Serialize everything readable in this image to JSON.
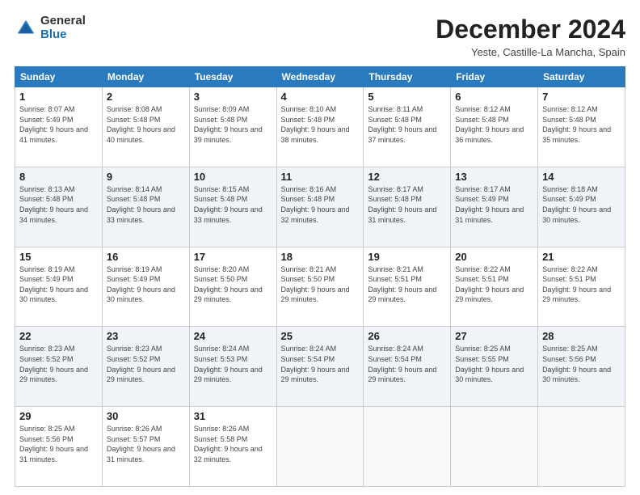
{
  "logo": {
    "general": "General",
    "blue": "Blue"
  },
  "title": "December 2024",
  "subtitle": "Yeste, Castille-La Mancha, Spain",
  "days_of_week": [
    "Sunday",
    "Monday",
    "Tuesday",
    "Wednesday",
    "Thursday",
    "Friday",
    "Saturday"
  ],
  "weeks": [
    [
      {
        "day": "1",
        "sunrise": "8:07 AM",
        "sunset": "5:49 PM",
        "daylight": "9 hours and 41 minutes."
      },
      {
        "day": "2",
        "sunrise": "8:08 AM",
        "sunset": "5:48 PM",
        "daylight": "9 hours and 40 minutes."
      },
      {
        "day": "3",
        "sunrise": "8:09 AM",
        "sunset": "5:48 PM",
        "daylight": "9 hours and 39 minutes."
      },
      {
        "day": "4",
        "sunrise": "8:10 AM",
        "sunset": "5:48 PM",
        "daylight": "9 hours and 38 minutes."
      },
      {
        "day": "5",
        "sunrise": "8:11 AM",
        "sunset": "5:48 PM",
        "daylight": "9 hours and 37 minutes."
      },
      {
        "day": "6",
        "sunrise": "8:12 AM",
        "sunset": "5:48 PM",
        "daylight": "9 hours and 36 minutes."
      },
      {
        "day": "7",
        "sunrise": "8:12 AM",
        "sunset": "5:48 PM",
        "daylight": "9 hours and 35 minutes."
      }
    ],
    [
      {
        "day": "8",
        "sunrise": "8:13 AM",
        "sunset": "5:48 PM",
        "daylight": "9 hours and 34 minutes."
      },
      {
        "day": "9",
        "sunrise": "8:14 AM",
        "sunset": "5:48 PM",
        "daylight": "9 hours and 33 minutes."
      },
      {
        "day": "10",
        "sunrise": "8:15 AM",
        "sunset": "5:48 PM",
        "daylight": "9 hours and 33 minutes."
      },
      {
        "day": "11",
        "sunrise": "8:16 AM",
        "sunset": "5:48 PM",
        "daylight": "9 hours and 32 minutes."
      },
      {
        "day": "12",
        "sunrise": "8:17 AM",
        "sunset": "5:48 PM",
        "daylight": "9 hours and 31 minutes."
      },
      {
        "day": "13",
        "sunrise": "8:17 AM",
        "sunset": "5:49 PM",
        "daylight": "9 hours and 31 minutes."
      },
      {
        "day": "14",
        "sunrise": "8:18 AM",
        "sunset": "5:49 PM",
        "daylight": "9 hours and 30 minutes."
      }
    ],
    [
      {
        "day": "15",
        "sunrise": "8:19 AM",
        "sunset": "5:49 PM",
        "daylight": "9 hours and 30 minutes."
      },
      {
        "day": "16",
        "sunrise": "8:19 AM",
        "sunset": "5:49 PM",
        "daylight": "9 hours and 30 minutes."
      },
      {
        "day": "17",
        "sunrise": "8:20 AM",
        "sunset": "5:50 PM",
        "daylight": "9 hours and 29 minutes."
      },
      {
        "day": "18",
        "sunrise": "8:21 AM",
        "sunset": "5:50 PM",
        "daylight": "9 hours and 29 minutes."
      },
      {
        "day": "19",
        "sunrise": "8:21 AM",
        "sunset": "5:51 PM",
        "daylight": "9 hours and 29 minutes."
      },
      {
        "day": "20",
        "sunrise": "8:22 AM",
        "sunset": "5:51 PM",
        "daylight": "9 hours and 29 minutes."
      },
      {
        "day": "21",
        "sunrise": "8:22 AM",
        "sunset": "5:51 PM",
        "daylight": "9 hours and 29 minutes."
      }
    ],
    [
      {
        "day": "22",
        "sunrise": "8:23 AM",
        "sunset": "5:52 PM",
        "daylight": "9 hours and 29 minutes."
      },
      {
        "day": "23",
        "sunrise": "8:23 AM",
        "sunset": "5:52 PM",
        "daylight": "9 hours and 29 minutes."
      },
      {
        "day": "24",
        "sunrise": "8:24 AM",
        "sunset": "5:53 PM",
        "daylight": "9 hours and 29 minutes."
      },
      {
        "day": "25",
        "sunrise": "8:24 AM",
        "sunset": "5:54 PM",
        "daylight": "9 hours and 29 minutes."
      },
      {
        "day": "26",
        "sunrise": "8:24 AM",
        "sunset": "5:54 PM",
        "daylight": "9 hours and 29 minutes."
      },
      {
        "day": "27",
        "sunrise": "8:25 AM",
        "sunset": "5:55 PM",
        "daylight": "9 hours and 30 minutes."
      },
      {
        "day": "28",
        "sunrise": "8:25 AM",
        "sunset": "5:56 PM",
        "daylight": "9 hours and 30 minutes."
      }
    ],
    [
      {
        "day": "29",
        "sunrise": "8:25 AM",
        "sunset": "5:56 PM",
        "daylight": "9 hours and 31 minutes."
      },
      {
        "day": "30",
        "sunrise": "8:26 AM",
        "sunset": "5:57 PM",
        "daylight": "9 hours and 31 minutes."
      },
      {
        "day": "31",
        "sunrise": "8:26 AM",
        "sunset": "5:58 PM",
        "daylight": "9 hours and 32 minutes."
      },
      null,
      null,
      null,
      null
    ]
  ]
}
